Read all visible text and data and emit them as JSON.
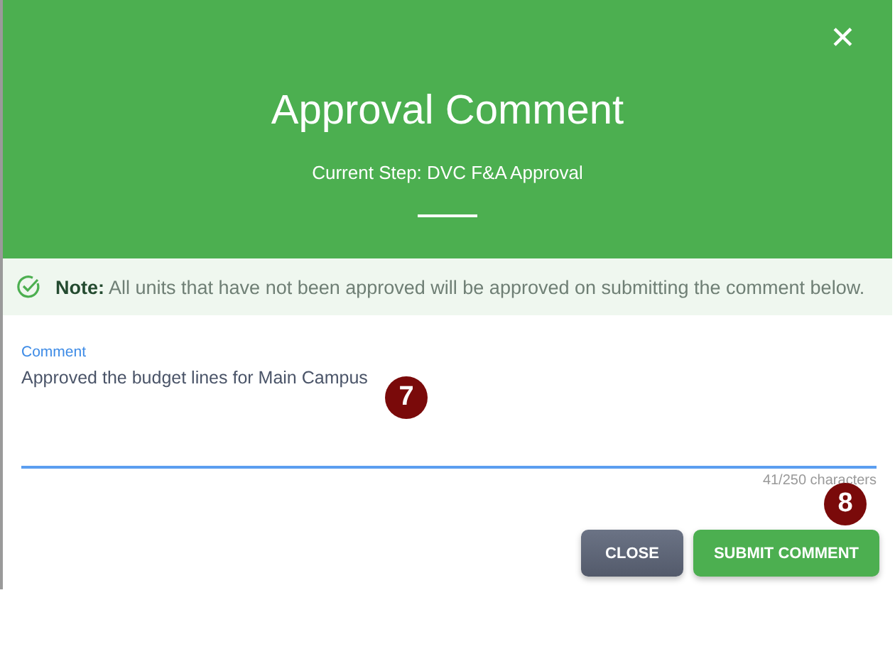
{
  "dialog": {
    "title": "Approval Comment",
    "subtitle": "Current Step: DVC F&A Approval",
    "close_icon": "✕"
  },
  "note": {
    "text": "**Note:** All units that have not been approved will be approved on submitting the comment below."
  },
  "comment_field": {
    "label": "Comment",
    "value": "Approved the budget lines for Main Campus",
    "counter": "41/250 characters"
  },
  "buttons": [
    {
      "label": "CLOSE",
      "kind": "secondary"
    },
    {
      "label": "SUBMIT COMMENT",
      "kind": "primary"
    }
  ],
  "callouts": [
    "7",
    "8"
  ]
}
